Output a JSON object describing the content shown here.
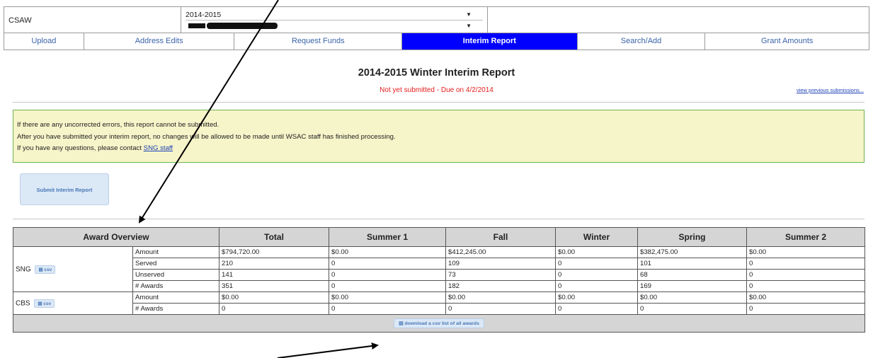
{
  "header": {
    "app_label": "CSAW",
    "year_select": "2014-2015",
    "school_select": ""
  },
  "tabs": [
    {
      "label": "Upload",
      "active": false
    },
    {
      "label": "Address Edits",
      "active": false
    },
    {
      "label": "Request Funds",
      "active": false
    },
    {
      "label": "Interim Report",
      "active": true
    },
    {
      "label": "Search/Add",
      "active": false
    },
    {
      "label": "Grant Amounts",
      "active": false
    }
  ],
  "report": {
    "title": "2014-2015 Winter Interim Report",
    "status": "Not yet submitted - Due on 4/2/2014",
    "previous_link": "view previous submissions..."
  },
  "notice": {
    "line1": "If there are any uncorrected errors, this report cannot be submitted.",
    "line2": "After you have submitted your interim report, no changes will be allowed to be made until WSAC staff has finished processing.",
    "line3_prefix": "If you have any questions, please contact ",
    "line3_link": "SNG staff"
  },
  "submit_button": "Submit Interim Report",
  "table": {
    "headers": [
      "Award Overview",
      "Total",
      "Summer 1",
      "Fall",
      "Winter",
      "Spring",
      "Summer 2"
    ],
    "csv_label": "csv",
    "groups": [
      {
        "name": "SNG",
        "rows": [
          {
            "label": "Amount",
            "values": [
              "$794,720.00",
              "$0.00",
              "$412,245.00",
              "$0.00",
              "$382,475.00",
              "$0.00"
            ]
          },
          {
            "label": "Served",
            "values": [
              "210",
              "0",
              "109",
              "0",
              "101",
              "0"
            ]
          },
          {
            "label": "Unserved",
            "values": [
              "141",
              "0",
              "73",
              "0",
              "68",
              "0"
            ]
          },
          {
            "label": "# Awards",
            "values": [
              "351",
              "0",
              "182",
              "0",
              "169",
              "0"
            ]
          }
        ]
      },
      {
        "name": "CBS",
        "rows": [
          {
            "label": "Amount",
            "values": [
              "$0.00",
              "$0.00",
              "$0.00",
              "$0.00",
              "$0.00",
              "$0.00"
            ]
          },
          {
            "label": "# Awards",
            "values": [
              "0",
              "0",
              "0",
              "0",
              "0",
              "0"
            ]
          }
        ]
      }
    ],
    "download_label": "download a csv list of all awards"
  }
}
